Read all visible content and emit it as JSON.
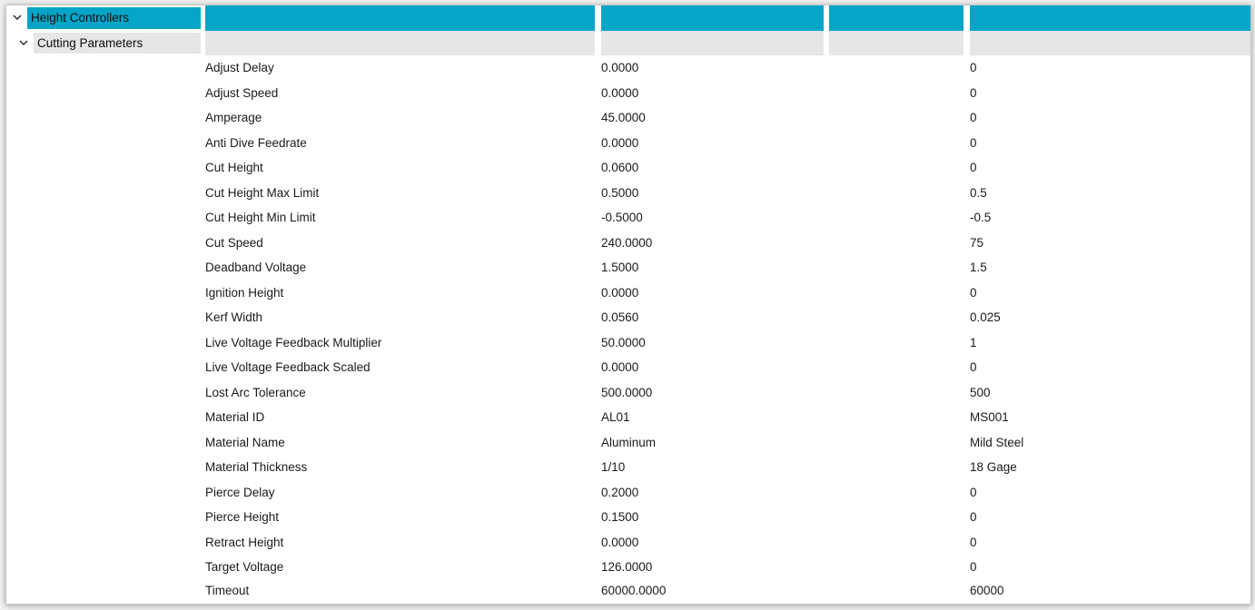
{
  "tree": {
    "root": {
      "label": "Height Controllers",
      "expanded_icon": "chevron-down-icon"
    },
    "group": {
      "label": "Cutting Parameters",
      "expanded_icon": "chevron-down-icon"
    }
  },
  "colors": {
    "header_band": "#05a5c8",
    "subheader_band": "#e4e6e8",
    "text": "#1a1a1a"
  },
  "parameters": [
    {
      "name": "Adjust Delay",
      "value1": "0.0000",
      "value2": "0"
    },
    {
      "name": "Adjust Speed",
      "value1": "0.0000",
      "value2": "0"
    },
    {
      "name": "Amperage",
      "value1": "45.0000",
      "value2": "0"
    },
    {
      "name": "Anti Dive Feedrate",
      "value1": "0.0000",
      "value2": "0"
    },
    {
      "name": "Cut Height",
      "value1": "0.0600",
      "value2": "0"
    },
    {
      "name": "Cut Height Max Limit",
      "value1": "0.5000",
      "value2": "0.5"
    },
    {
      "name": "Cut Height Min Limit",
      "value1": "-0.5000",
      "value2": "-0.5"
    },
    {
      "name": "Cut Speed",
      "value1": "240.0000",
      "value2": "75"
    },
    {
      "name": "Deadband Voltage",
      "value1": "1.5000",
      "value2": "1.5"
    },
    {
      "name": "Ignition Height",
      "value1": "0.0000",
      "value2": "0"
    },
    {
      "name": "Kerf Width",
      "value1": "0.0560",
      "value2": "0.025"
    },
    {
      "name": "Live Voltage Feedback Multiplier",
      "value1": "50.0000",
      "value2": "1"
    },
    {
      "name": "Live Voltage Feedback Scaled",
      "value1": "0.0000",
      "value2": "0"
    },
    {
      "name": "Lost Arc Tolerance",
      "value1": "500.0000",
      "value2": "500"
    },
    {
      "name": "Material ID",
      "value1": "AL01",
      "value2": "MS001"
    },
    {
      "name": "Material Name",
      "value1": "Aluminum",
      "value2": "Mild Steel"
    },
    {
      "name": "Material Thickness",
      "value1": "1/10",
      "value2": "18 Gage"
    },
    {
      "name": "Pierce Delay",
      "value1": "0.2000",
      "value2": "0"
    },
    {
      "name": "Pierce Height",
      "value1": "0.1500",
      "value2": "0"
    },
    {
      "name": "Retract Height",
      "value1": "0.0000",
      "value2": "0"
    },
    {
      "name": "Target Voltage",
      "value1": "126.0000",
      "value2": "0"
    },
    {
      "name": "Timeout",
      "value1": "60000.0000",
      "value2": "60000"
    }
  ]
}
